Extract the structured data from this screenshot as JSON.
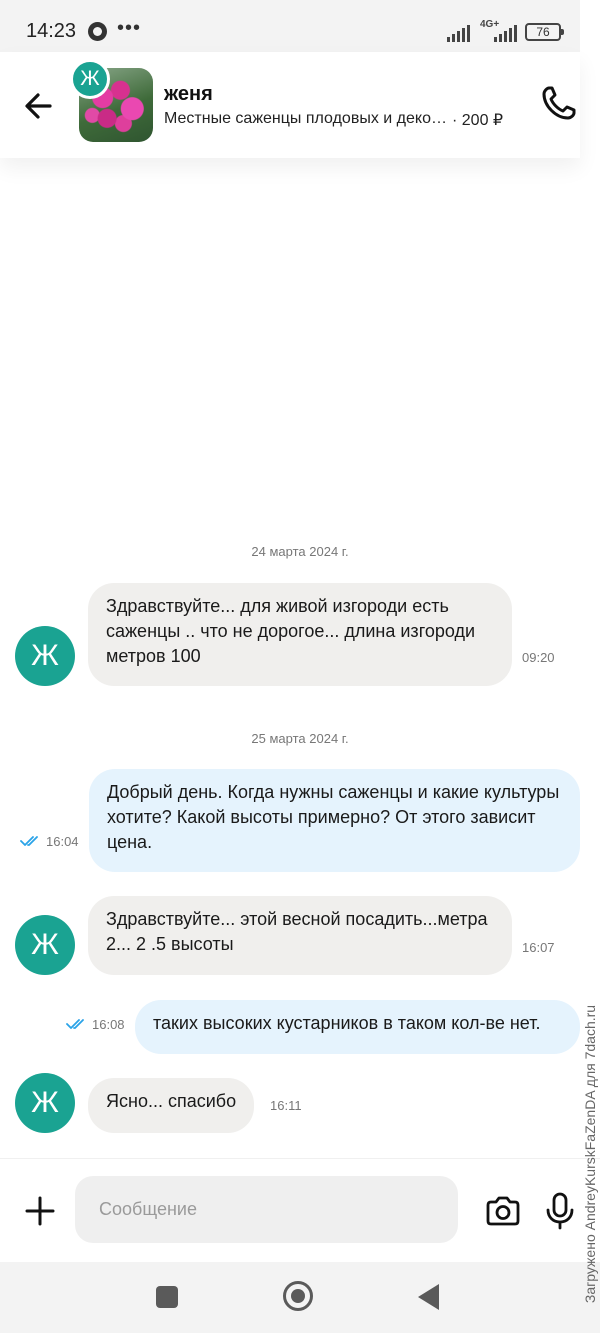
{
  "status_bar": {
    "time": "14:23",
    "dots": "•••",
    "network": "4G+",
    "battery": "76"
  },
  "header": {
    "contact_name": "женя",
    "contact_initial": "Ж",
    "listing_title": "Местные саженцы плодовых и деко…",
    "listing_price": "· 200 ₽"
  },
  "messages": [
    {
      "type": "date",
      "text": "24 марта 2024 г."
    },
    {
      "type": "incoming",
      "avatar": "Ж",
      "text": "Здравствуйте... для живой изгороди есть саженцы .. что не дорогое... длина изгороди метров 100",
      "time": "09:20"
    },
    {
      "type": "date",
      "text": "25 марта 2024 г."
    },
    {
      "type": "outgoing",
      "read": true,
      "text": "Добрый день. Когда нужны саженцы и какие культуры хотите? Какой высоты примерно? От этого зависит цена.",
      "time": "16:04"
    },
    {
      "type": "incoming",
      "avatar": "Ж",
      "text": "Здравствуйте... этой весной посадить...метра 2... 2 .5 высоты",
      "time": "16:07"
    },
    {
      "type": "outgoing",
      "read": true,
      "text": "таких высоких кустарников в таком кол-ве нет.",
      "time": "16:08"
    },
    {
      "type": "incoming",
      "avatar": "Ж",
      "text": "Ясно... спасибо",
      "time": "16:11"
    }
  ],
  "composer": {
    "placeholder": "Сообщение"
  },
  "watermark": "Загружено AndreyKurskFaZenDA для 7dach.ru",
  "colors": {
    "avatar": "#1aa392",
    "incoming_bubble": "#f0efed",
    "outgoing_bubble": "#e5f3fd",
    "read_check": "#2aa3e8"
  },
  "icons": {
    "back": "arrow-left-icon",
    "call": "phone-icon",
    "attach": "plus-icon",
    "camera": "camera-icon",
    "mic": "microphone-icon",
    "read": "double-check-icon"
  }
}
